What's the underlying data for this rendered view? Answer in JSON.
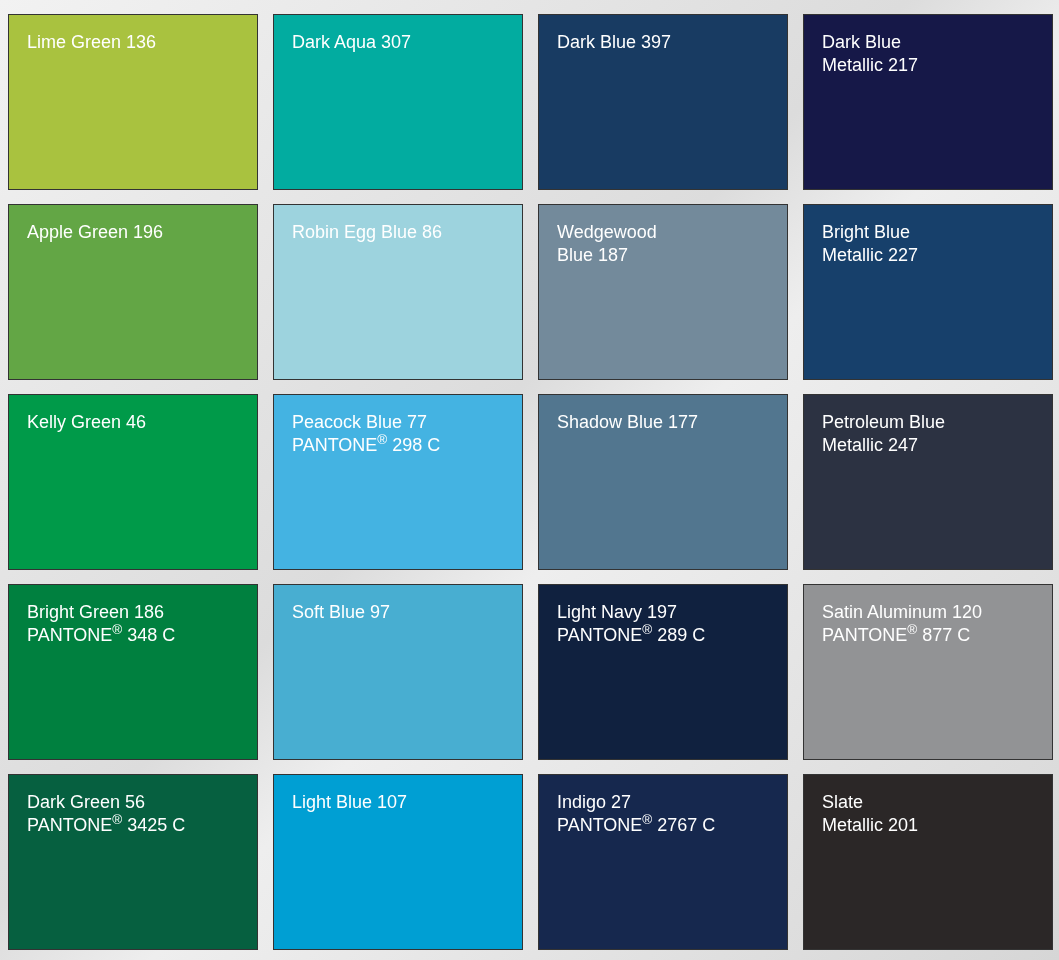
{
  "swatches": [
    {
      "lines": [
        "Lime Green 136"
      ],
      "color": "#a9c23f"
    },
    {
      "lines": [
        "Dark Aqua 307"
      ],
      "color": "#02aca0"
    },
    {
      "lines": [
        "Dark Blue 397"
      ],
      "color": "#183b62"
    },
    {
      "lines": [
        "Dark Blue",
        "Metallic 217"
      ],
      "color": "#161848"
    },
    {
      "lines": [
        "Apple Green 196"
      ],
      "color": "#63a645"
    },
    {
      "lines": [
        "Robin Egg Blue 86"
      ],
      "color": "#9dd3de"
    },
    {
      "lines": [
        "Wedgewood",
        "Blue 187"
      ],
      "color": "#738a9b"
    },
    {
      "lines": [
        "Bright Blue",
        "Metallic 227"
      ],
      "color": "#17406b"
    },
    {
      "lines": [
        "Kelly Green 46"
      ],
      "color": "#009a49"
    },
    {
      "lines": [
        "Peacock Blue 77",
        "PANTONE$^{®}$ 298 C"
      ],
      "color": "#44b3e2"
    },
    {
      "lines": [
        "Shadow Blue 177"
      ],
      "color": "#52768f"
    },
    {
      "lines": [
        "Petroleum Blue",
        "Metallic 247"
      ],
      "color": "#2c3242"
    },
    {
      "lines": [
        "Bright Green 186",
        "PANTONE$^{®}$ 348 C"
      ],
      "color": "#00803f"
    },
    {
      "lines": [
        "Soft Blue 97"
      ],
      "color": "#48aed1"
    },
    {
      "lines": [
        "Light Navy 197",
        "PANTONE$^{®}$ 289 C"
      ],
      "color": "#10213f"
    },
    {
      "lines": [
        "Satin Aluminum 120",
        "PANTONE$^{®}$ 877 C"
      ],
      "color": "#929395"
    },
    {
      "lines": [
        "Dark Green 56",
        "PANTONE$^{®}$ 3425 C"
      ],
      "color": "#066040"
    },
    {
      "lines": [
        "Light Blue 107"
      ],
      "color": "#009fd3"
    },
    {
      "lines": [
        "Indigo 27",
        "PANTONE$^{®}$ 2767 C"
      ],
      "color": "#16284e"
    },
    {
      "lines": [
        "Slate",
        "Metallic 201"
      ],
      "color": "#2b2727"
    }
  ]
}
